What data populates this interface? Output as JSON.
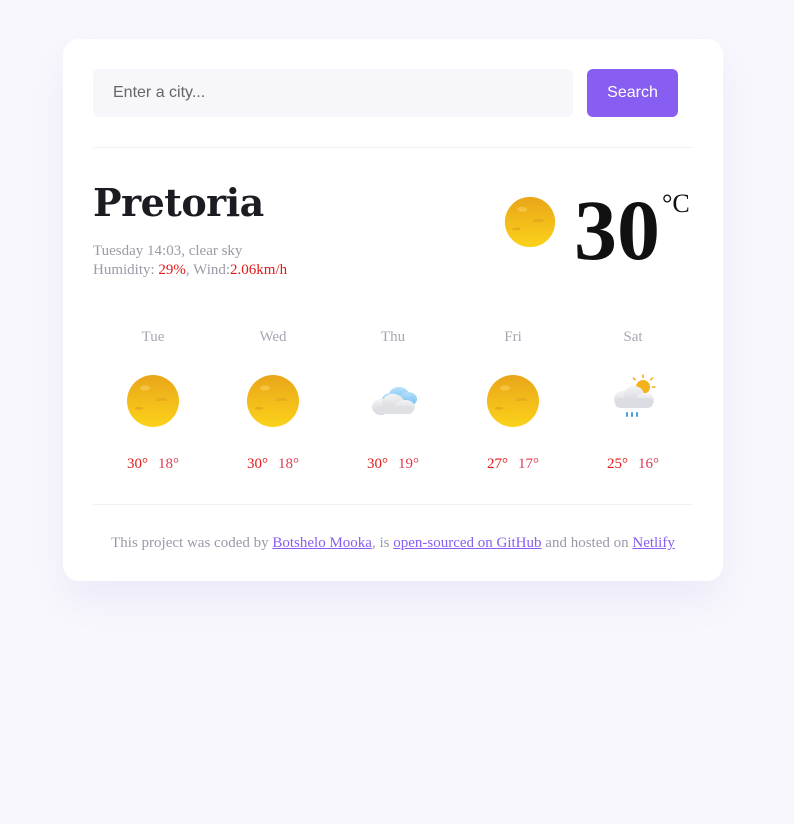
{
  "search": {
    "placeholder": "Enter a city...",
    "value": "",
    "button_label": "Search"
  },
  "current": {
    "city": "Pretoria",
    "datetime_description": "Tuesday 14:03, clear sky",
    "humidity_label": "Humidity: ",
    "humidity_value": "29%",
    "wind_label": ", Wind:",
    "wind_value": "2.06km/h",
    "temperature": "30",
    "unit": "°C",
    "icon": "sun-icon"
  },
  "forecast": [
    {
      "day": "Tue",
      "max": "30°",
      "min": "18°",
      "icon": "sun-icon"
    },
    {
      "day": "Wed",
      "max": "30°",
      "min": "18°",
      "icon": "sun-icon"
    },
    {
      "day": "Thu",
      "max": "30°",
      "min": "19°",
      "icon": "cloud-icon"
    },
    {
      "day": "Fri",
      "max": "27°",
      "min": "17°",
      "icon": "sun-icon"
    },
    {
      "day": "Sat",
      "max": "25°",
      "min": "16°",
      "icon": "rain-sun-icon"
    }
  ],
  "footer": {
    "text_1": "This project was coded by ",
    "author_link": "Botshelo Mooka",
    "text_2": ", is ",
    "github_link": "open-sourced on GitHub",
    "text_3": " and hosted on ",
    "host_link": "Netlify"
  },
  "colors": {
    "accent": "#885df1",
    "background": "#f8f7fd",
    "highlight": "#e01b1b"
  }
}
